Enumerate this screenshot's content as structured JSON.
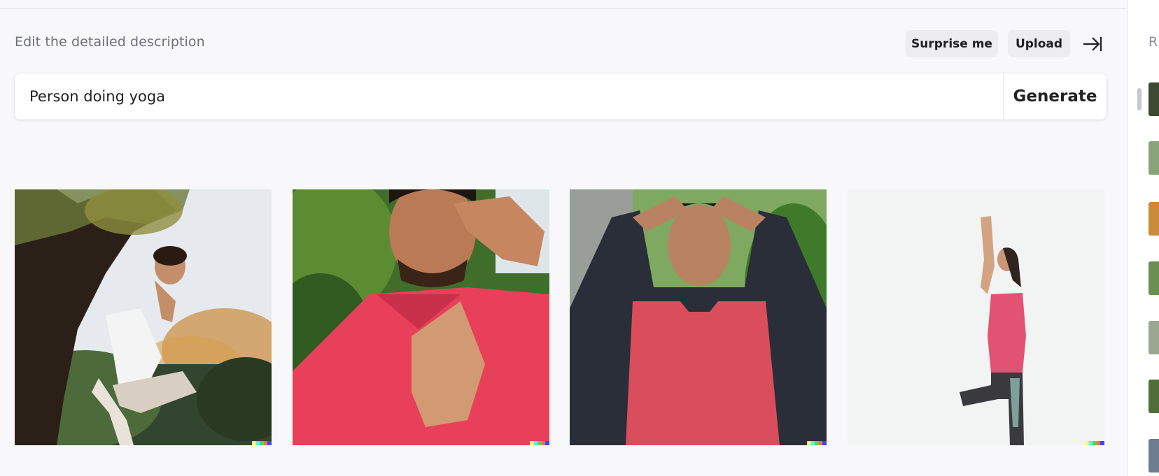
{
  "header": {
    "description_label": "Edit the detailed description",
    "surprise_label": "Surprise me",
    "upload_label": "Upload"
  },
  "prompt": {
    "value": "Person doing yoga",
    "placeholder": "",
    "generate_label": "Generate"
  },
  "results": [
    {
      "name": "result-image-1",
      "subject": "man balancing in yoga pose under tree, white shirt, beige pants"
    },
    {
      "name": "result-image-2",
      "subject": "man in red t-shirt, hand raised to forehead, palm forward"
    },
    {
      "name": "result-image-3",
      "subject": "man in red and black raglan shirt, hands on head, eyes closed"
    },
    {
      "name": "result-image-4",
      "subject": "woman in pink tank top, tree pose, arms raised, white background"
    }
  ],
  "history_panel": {
    "title_partial": "R",
    "thumbnail_count": 7
  },
  "colors": {
    "background": "#f8f8fa",
    "chip_bg": "#ececf1",
    "text": "#202123",
    "muted_text": "#6e6e80",
    "signature": [
      "#ffff66",
      "#42ffff",
      "#51da4c",
      "#ff6e3c",
      "#3c46ff"
    ]
  }
}
